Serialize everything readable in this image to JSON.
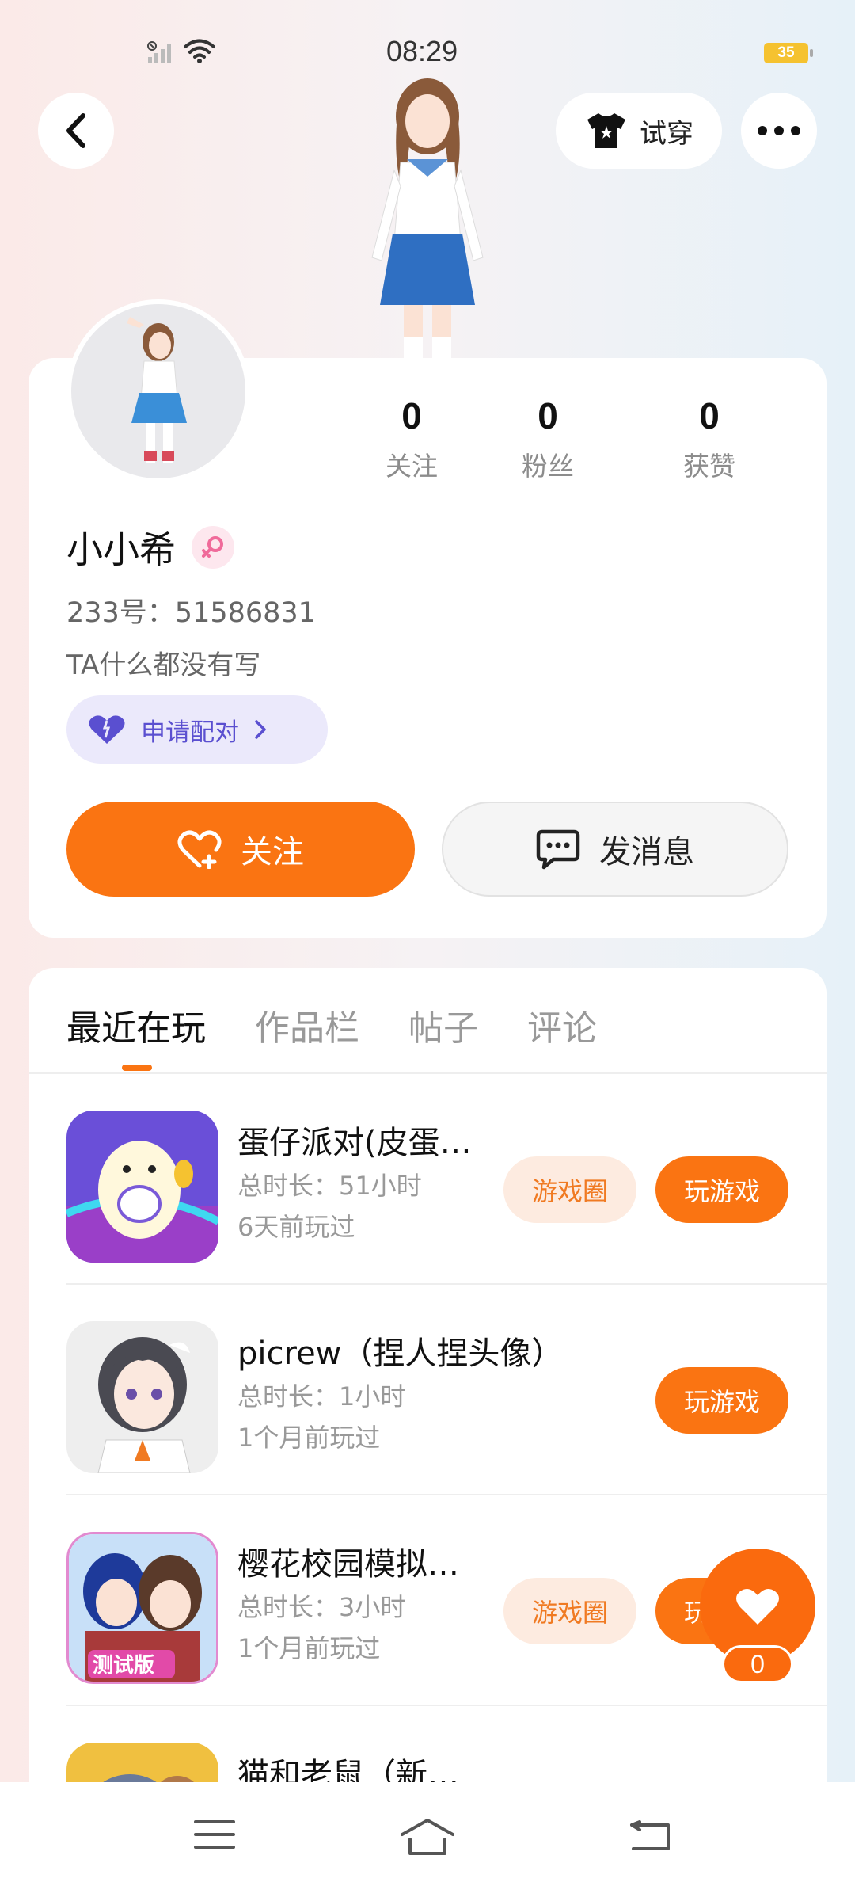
{
  "status_bar": {
    "time": "08:29",
    "battery": "35"
  },
  "header": {
    "tryon_label": "试穿"
  },
  "profile": {
    "stats": [
      {
        "value": "0",
        "label": "关注"
      },
      {
        "value": "0",
        "label": "粉丝"
      },
      {
        "value": "0",
        "label": "获赞"
      }
    ],
    "username": "小小希",
    "user_id": "233号：51586831",
    "bio": "TA什么都没有写",
    "pair_label": "申请配对",
    "follow_label": "关注",
    "message_label": "发消息"
  },
  "tabs": [
    {
      "label": "最近在玩",
      "active": true
    },
    {
      "label": "作品栏",
      "active": false
    },
    {
      "label": "帖子",
      "active": false
    },
    {
      "label": "评论",
      "active": false
    }
  ],
  "games": [
    {
      "title": "蛋仔派对(皮蛋…",
      "duration": "总时长：51小时",
      "last_played": "6天前玩过",
      "circle_label": "游戏圈",
      "play_label": "玩游戏"
    },
    {
      "title": "picrew（捏人捏头像）",
      "duration": "总时长：1小时",
      "last_played": "1个月前玩过",
      "play_label": "玩游戏"
    },
    {
      "title": "樱花校园模拟…",
      "duration": "总时长：3小时",
      "last_played": "1个月前玩过",
      "circle_label": "游戏圈",
      "play_label": "玩游戏"
    },
    {
      "title": "猫和老鼠（新…"
    }
  ],
  "icon_badge_text": "测试版",
  "like_fab": {
    "count": "0"
  },
  "colors": {
    "accent": "#fa7412",
    "pair": "#5a4fd0"
  }
}
